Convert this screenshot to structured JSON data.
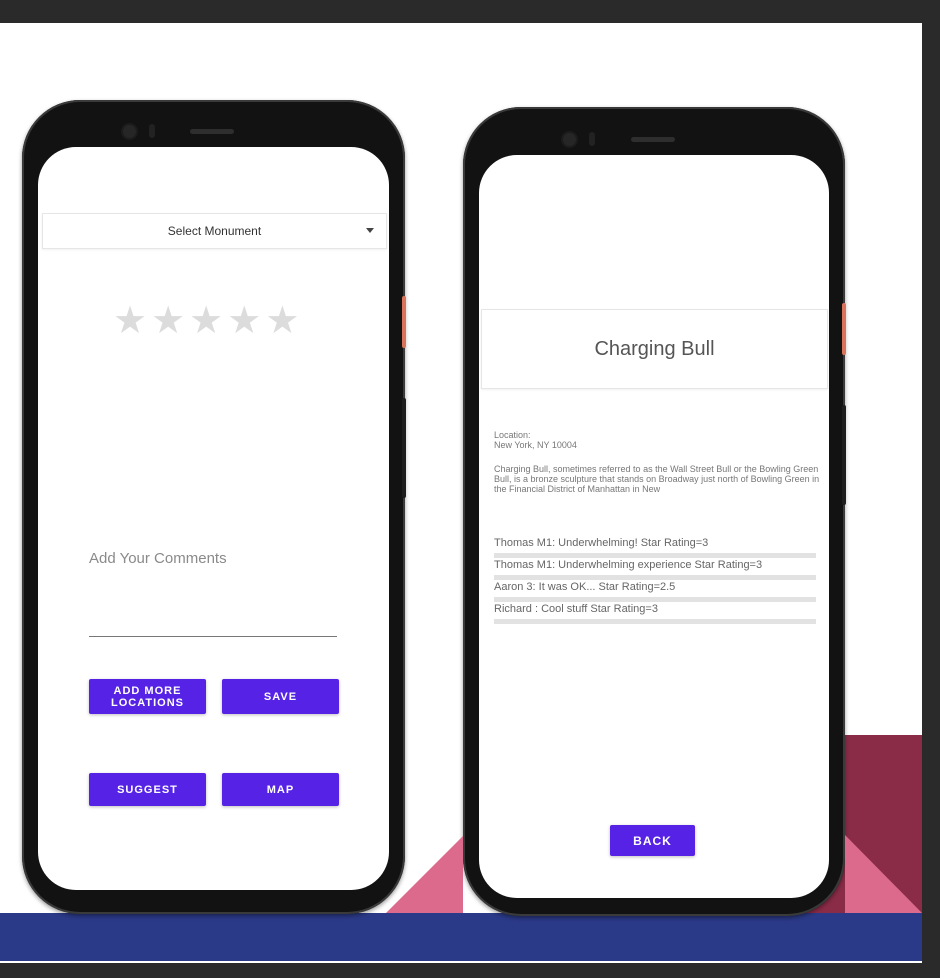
{
  "left_screen": {
    "select": {
      "label": "Select Monument"
    },
    "rating": {
      "value": 0,
      "max": 5
    },
    "comment": {
      "placeholder": "Add Your Comments"
    },
    "buttons": {
      "add_more_line1": "ADD MORE",
      "add_more_line2": "LOCATIONS",
      "save": "SAVE",
      "suggest": "SUGGEST",
      "map": "MAP"
    }
  },
  "right_screen": {
    "title": "Charging Bull",
    "location_label": "Location:",
    "location_value": "New York, NY 10004",
    "description": "Charging Bull, sometimes referred to as the Wall Street Bull or the Bowling Green Bull, is a bronze sculpture that stands on Broadway just north of Bowling Green in the Financial District of Manhattan in New",
    "reviews": [
      {
        "text": "Thomas M1: Underwhelming! Star Rating=3"
      },
      {
        "text": "Thomas M1: Underwhelming experience Star Rating=3"
      },
      {
        "text": "Aaron 3: It was OK... Star Rating=2.5"
      },
      {
        "text": "Richard : Cool stuff Star Rating=3"
      }
    ],
    "back_button": "BACK"
  },
  "colors": {
    "button": "#5522e6",
    "accent_maroon": "#8a2c48",
    "accent_pink": "#dc6a8c",
    "band_blue": "#2b3a88"
  }
}
